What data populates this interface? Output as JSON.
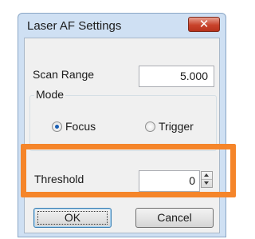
{
  "window": {
    "title": "Laser AF Settings",
    "close_icon": "close-icon"
  },
  "scan_range": {
    "label": "Scan Range",
    "value": "5.000"
  },
  "mode": {
    "group_label": "Mode",
    "options": [
      {
        "label": "Focus",
        "selected": true
      },
      {
        "label": "Trigger",
        "selected": false
      }
    ]
  },
  "threshold": {
    "label": "Threshold",
    "value": "0"
  },
  "buttons": {
    "ok_label": "OK",
    "cancel_label": "Cancel"
  },
  "colors": {
    "highlight": "#f5852a",
    "close_button": "#c8432b",
    "window_frame": "#cfe0f3"
  }
}
